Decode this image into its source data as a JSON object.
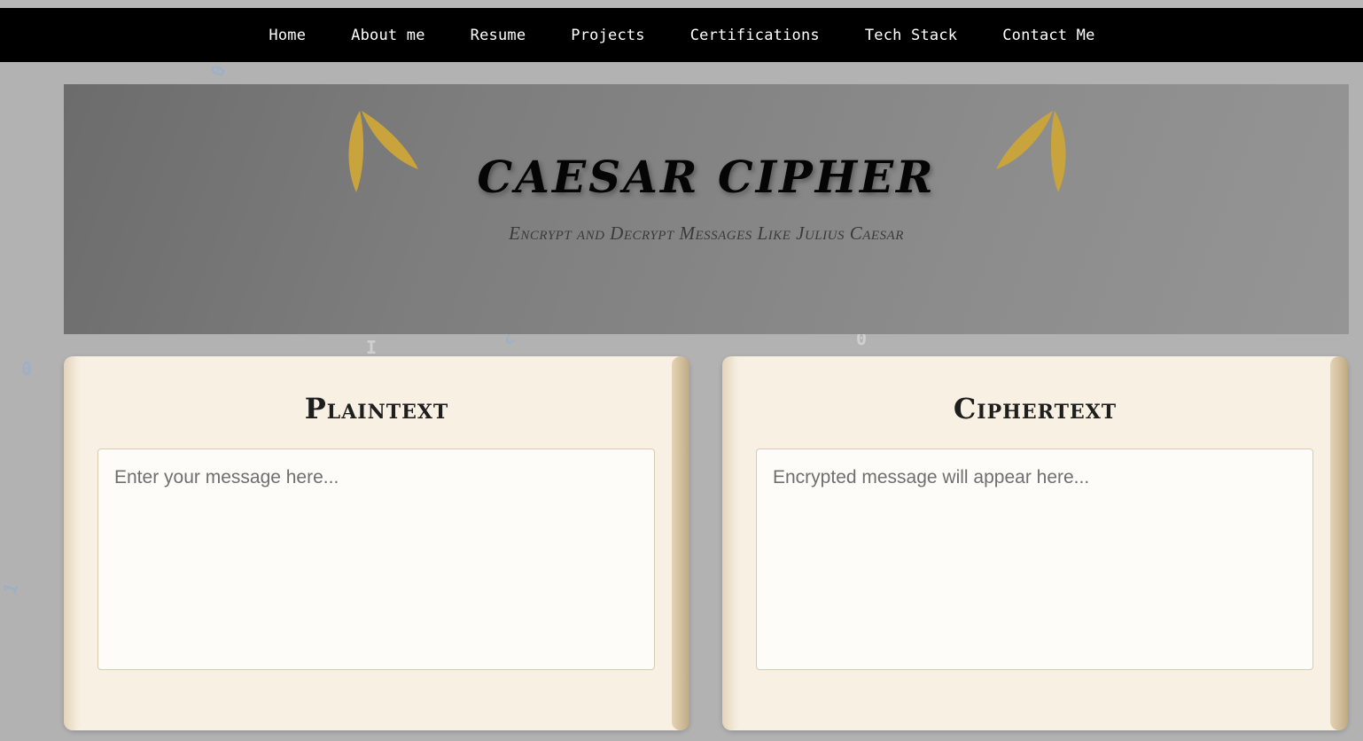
{
  "nav": {
    "items": [
      {
        "label": "Home"
      },
      {
        "label": "About me"
      },
      {
        "label": "Resume"
      },
      {
        "label": "Projects"
      },
      {
        "label": "Certifications"
      },
      {
        "label": "Tech Stack"
      },
      {
        "label": "Contact Me"
      }
    ]
  },
  "hero": {
    "title": "CAESAR CIPHER",
    "subtitle": "Encrypt and Decrypt Messages Like Julius Caesar",
    "laurel_color": "#c9a43c"
  },
  "background_glyphs": [
    "0",
    "I",
    "2",
    "0",
    "0",
    "1"
  ],
  "plaintext_panel": {
    "heading": "Plaintext",
    "placeholder": "Enter your message here...",
    "value": ""
  },
  "ciphertext_panel": {
    "heading": "Ciphertext",
    "placeholder": "Encrypted message will appear here...",
    "value": ""
  },
  "colors": {
    "nav_bg": "#000000",
    "page_bg": "#b2b2b2",
    "panel_bg": "#f8f0e3",
    "glyph_blue": "#8fb0d8"
  }
}
